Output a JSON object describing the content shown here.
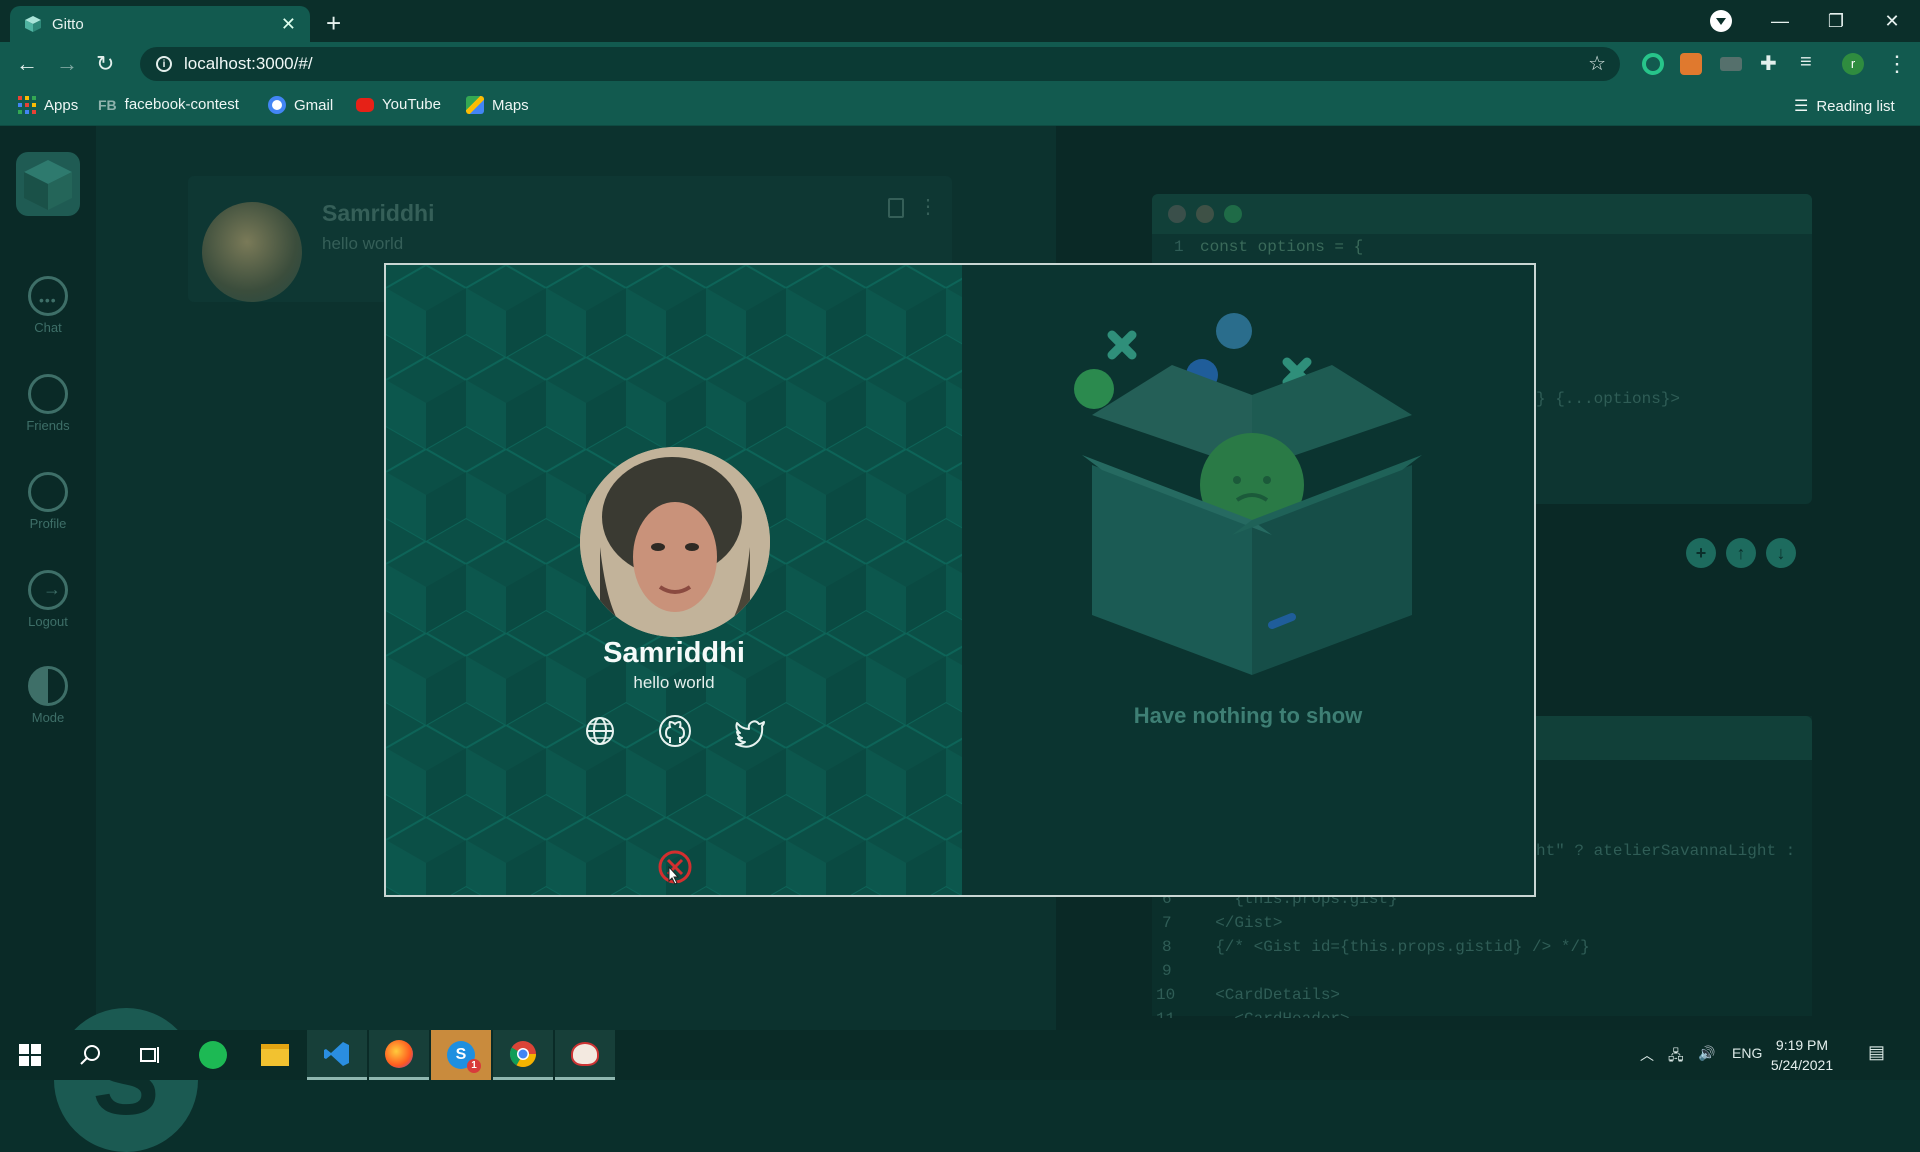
{
  "browser": {
    "tab_title": "Gitto",
    "url": "localhost:3000/#/",
    "bookmarks": [
      {
        "label": "Apps"
      },
      {
        "label": "facebook-contest"
      },
      {
        "label": "Gmail"
      },
      {
        "label": "YouTube"
      },
      {
        "label": "Maps"
      }
    ],
    "fb_prefix": "FB",
    "reading_list": "Reading list",
    "profile_initial": "r"
  },
  "sidebar": {
    "items": [
      {
        "label": "Chat",
        "icon": "chat-icon"
      },
      {
        "label": "Friends",
        "icon": "friends-icon"
      },
      {
        "label": "Profile",
        "icon": "profile-icon"
      },
      {
        "label": "Logout",
        "icon": "logout-icon"
      },
      {
        "label": "Mode",
        "icon": "mode-icon"
      }
    ]
  },
  "card": {
    "name": "Samriddhi",
    "status": "hello world"
  },
  "code": {
    "line1_num": "1",
    "line1": "const options = {",
    "frag1": "} {...options}>",
    "frag2": "ht\" ? atelierSavannaLight :",
    "lines": [
      {
        "num": "6",
        "text": "    {this.props.gist}"
      },
      {
        "num": "7",
        "text": "  </Gist>"
      },
      {
        "num": "8",
        "text": "  {/* <Gist id={this.props.gistid} /> */}"
      },
      {
        "num": "9",
        "text": ""
      },
      {
        "num": "10",
        "text": "  <CardDetails>"
      },
      {
        "num": "11",
        "text": "    <CardHeader>"
      }
    ]
  },
  "modal": {
    "name": "Samriddhi",
    "status": "hello world",
    "empty_text": "Have nothing to show"
  },
  "fabs": [
    "+",
    "↑",
    "↓"
  ],
  "skype_letter": "S",
  "taskbar": {
    "lang": "ENG",
    "time": "9:19 PM",
    "date": "5/24/2021",
    "skype_badge": "1"
  },
  "colors": {
    "accent": "#125a4f",
    "modal_left": "#0b4f46",
    "close_red": "#d32f2f"
  }
}
